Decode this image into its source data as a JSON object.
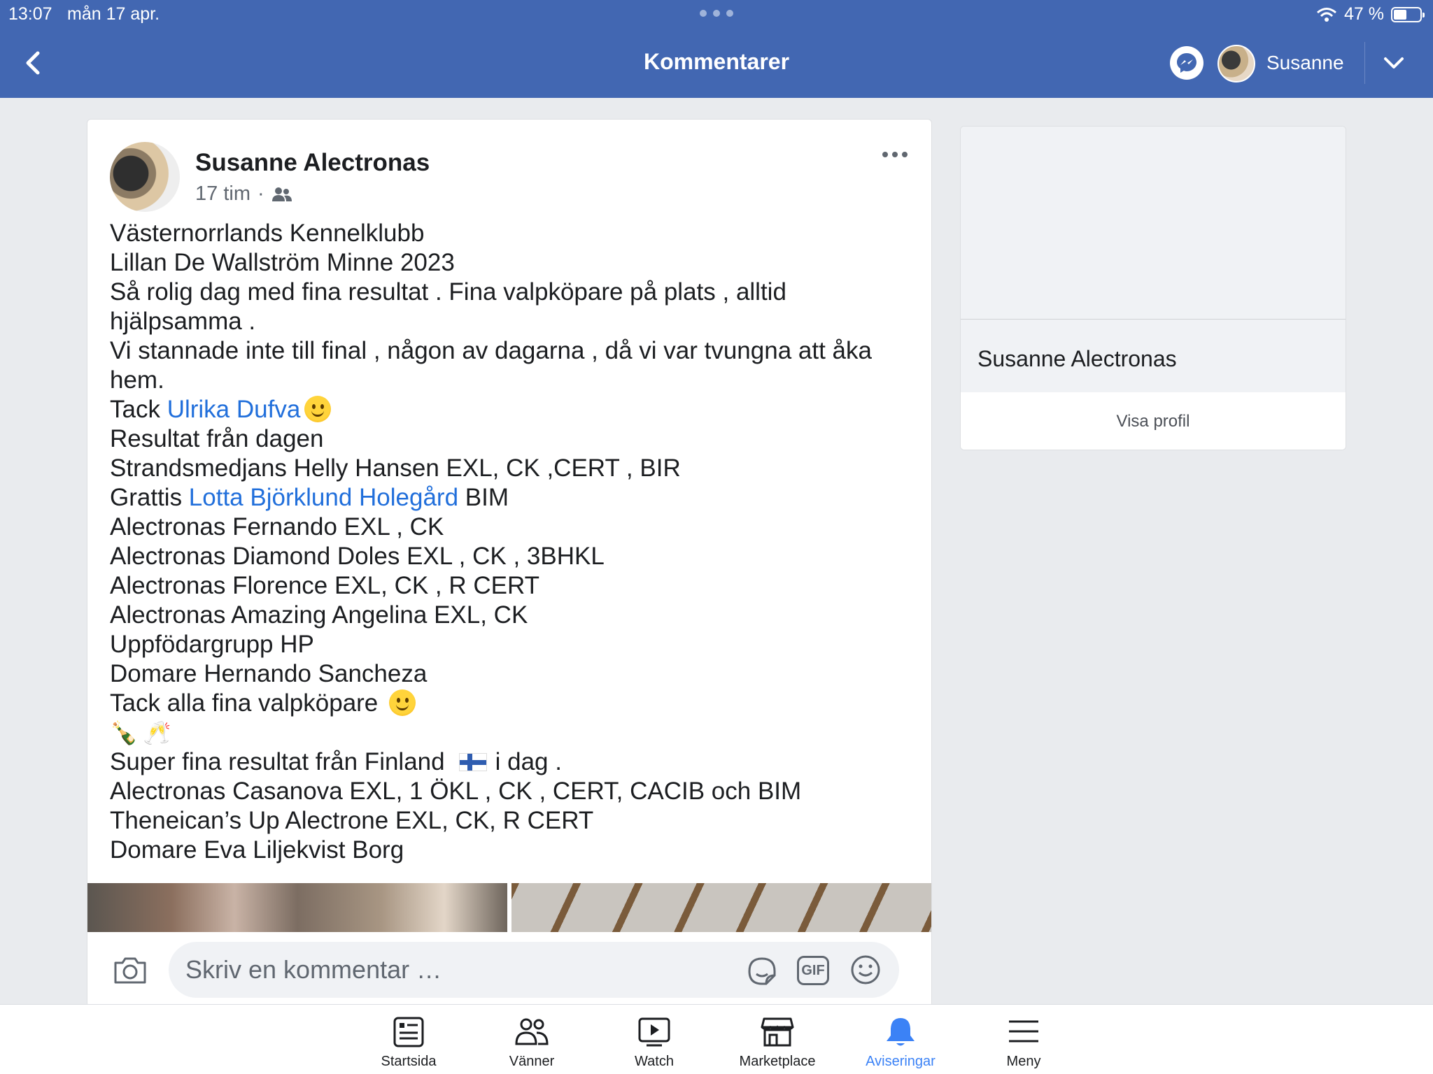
{
  "status_bar": {
    "time": "13:07",
    "date": "mån 17 apr.",
    "battery": "47 %"
  },
  "header": {
    "title": "Kommentarer",
    "user_name": "Susanne"
  },
  "post": {
    "author": "Susanne Alectronas",
    "time": "17 tim",
    "separator": "·",
    "lines": {
      "l1": "Västernorrlands Kennelklubb",
      "l2": "Lillan De Wallström Minne 2023",
      "l3": "Så rolig dag med fina resultat . Fina valpköpare på plats , alltid",
      "l4": "hjälpsamma .",
      "l5": "Vi stannade inte till final , någon av dagarna , då vi var tvungna att åka",
      "l6": "hem.",
      "l7_prefix": "Tack ",
      "l7_link": "Ulrika Dufva",
      "l8": "Resultat från dagen",
      "l9": "Strandsmedjans Helly Hansen EXL, CK ,CERT , BIR",
      "l10_prefix": "Grattis ",
      "l10_link": "Lotta Björklund Holegård",
      "l10_suffix": " BIM",
      "l11": "Alectronas Fernando EXL , CK",
      "l12": "Alectronas Diamond Doles EXL , CK , 3BHKL",
      "l13": "Alectronas Florence EXL, CK , R CERT",
      "l14": "Alectronas Amazing Angelina EXL, CK",
      "l15": "Uppfödargrupp HP",
      "l16": "Domare Hernando Sancheza",
      "l17": "Tack alla fina valpköpare",
      "l18": "🍾🥂",
      "l19_prefix": "Super fina resultat från Finland",
      "l19_suffix": "i dag .",
      "l20": "Alectronas Casanova EXL, 1 ÖKL , CK , CERT, CACIB och BIM",
      "l21": "Theneican’s Up Alectrone EXL, CK, R CERT",
      "l22": "Domare Eva Liljekvist Borg"
    },
    "comment_placeholder": "Skriv en kommentar …",
    "gif_label": "GIF"
  },
  "profile_card": {
    "name": "Susanne Alectronas",
    "button": "Visa profil"
  },
  "tabs": [
    {
      "label": "Startsida",
      "icon": "news-feed-icon"
    },
    {
      "label": "Vänner",
      "icon": "friends-icon"
    },
    {
      "label": "Watch",
      "icon": "watch-icon"
    },
    {
      "label": "Marketplace",
      "icon": "marketplace-icon"
    },
    {
      "label": "Aviseringar",
      "icon": "bell-icon",
      "active": true
    },
    {
      "label": "Meny",
      "icon": "menu-icon"
    }
  ],
  "colors": {
    "header": "#4267b2",
    "link": "#216fdb",
    "active_tab": "#3b82f6"
  }
}
